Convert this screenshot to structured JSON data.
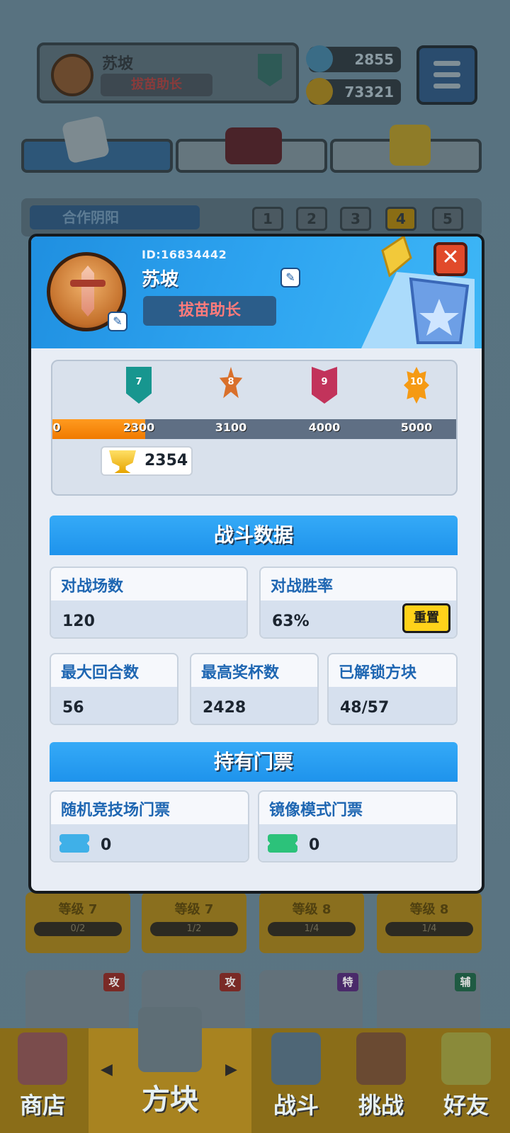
{
  "header": {
    "player_name": "苏坡",
    "player_title": "拔苗助长",
    "rank_level": "7",
    "gems": "2855",
    "gold": "73321"
  },
  "section": {
    "name": "合作阴阳",
    "pages": [
      "1",
      "2",
      "3",
      "4",
      "5"
    ],
    "active_page": "4"
  },
  "cards": [
    {
      "level": "等级 7",
      "progress": "0/2",
      "progress_fraction": 0
    },
    {
      "level": "等级 7",
      "progress": "1/2",
      "progress_fraction": 0.5
    },
    {
      "level": "等级 8",
      "progress": "1/4",
      "progress_fraction": 0.25
    },
    {
      "level": "等级 8",
      "progress": "1/4",
      "progress_fraction": 0.25
    }
  ],
  "block_types": [
    "攻",
    "攻",
    "特",
    "辅"
  ],
  "bottom_nav": {
    "shop": "商店",
    "blocks": "方块",
    "battle": "战斗",
    "challenge": "挑战",
    "friends": "好友"
  },
  "profile": {
    "id": "ID:16834442",
    "name": "苏坡",
    "title": "拔苗助长",
    "close_label": "✕",
    "rank_progress": {
      "milestones": [
        {
          "badge": "7",
          "trophies": "2300"
        },
        {
          "badge": "8",
          "trophies": "3100"
        },
        {
          "badge": "9",
          "trophies": "4000"
        },
        {
          "badge": "10",
          "trophies": "5000"
        }
      ],
      "partial_left_label": "0",
      "current_trophies": "2354"
    },
    "battle_section_title": "战斗数据",
    "stats": {
      "matches_label": "对战场数",
      "matches_value": "120",
      "winrate_label": "对战胜率",
      "winrate_value": "63%",
      "reset_label": "重置",
      "max_rounds_label": "最大回合数",
      "max_rounds_value": "56",
      "max_trophies_label": "最高奖杯数",
      "max_trophies_value": "2428",
      "unlocked_label": "已解锁方块",
      "unlocked_value": "48/57"
    },
    "tickets_section_title": "持有门票",
    "tickets": {
      "arena_label": "随机竞技场门票",
      "arena_value": "0",
      "mirror_label": "镜像模式门票",
      "mirror_value": "0"
    }
  },
  "colors": {
    "accent_blue": "#2ea4f0",
    "title_red": "#ff7b7b",
    "reset_yellow": "#ffd21a",
    "progress_orange": "#f07a00"
  }
}
